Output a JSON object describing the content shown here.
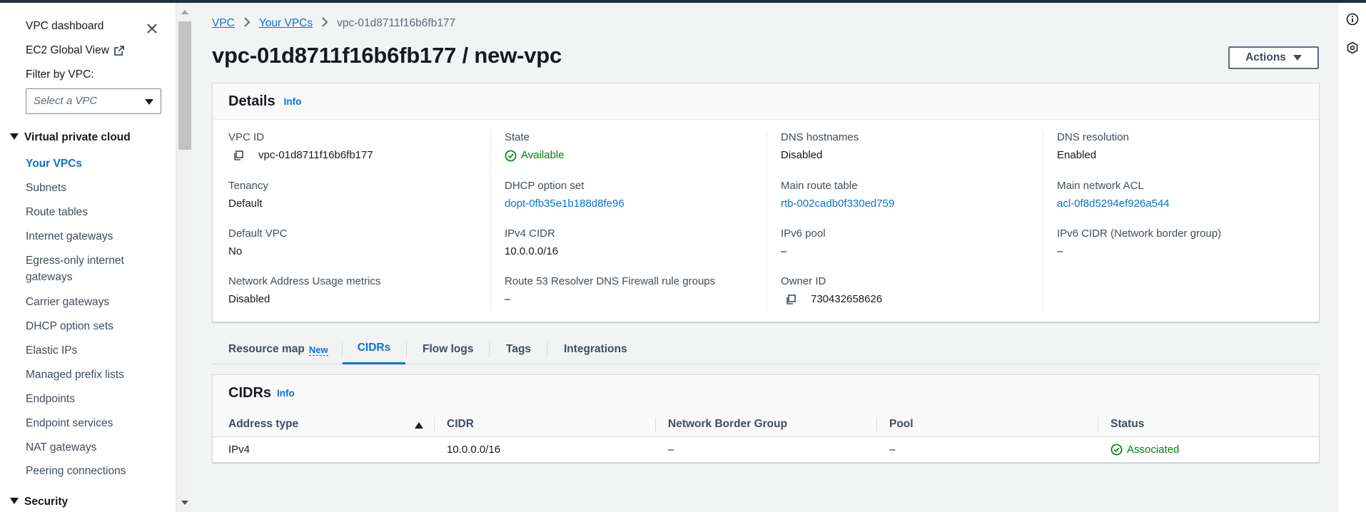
{
  "sidebar": {
    "dashboard_label": "VPC dashboard",
    "global_view_label": "EC2 Global View",
    "filter_label": "Filter by VPC:",
    "filter_placeholder": "Select a VPC",
    "section_vpc": "Virtual private cloud",
    "items": [
      "Your VPCs",
      "Subnets",
      "Route tables",
      "Internet gateways",
      "Egress-only internet gateways",
      "Carrier gateways",
      "DHCP option sets",
      "Elastic IPs",
      "Managed prefix lists",
      "Endpoints",
      "Endpoint services",
      "NAT gateways",
      "Peering connections"
    ],
    "active_item": "Your VPCs",
    "section_security": "Security"
  },
  "breadcrumb": {
    "root": "VPC",
    "parent": "Your VPCs",
    "current": "vpc-01d8711f16b6fb177"
  },
  "header": {
    "title": "vpc-01d8711f16b6fb177 / new-vpc",
    "actions_label": "Actions"
  },
  "details": {
    "title": "Details",
    "info_label": "Info",
    "vpc_id_label": "VPC ID",
    "vpc_id_value": "vpc-01d8711f16b6fb177",
    "state_label": "State",
    "state_value": "Available",
    "dns_hostnames_label": "DNS hostnames",
    "dns_hostnames_value": "Disabled",
    "dns_resolution_label": "DNS resolution",
    "dns_resolution_value": "Enabled",
    "tenancy_label": "Tenancy",
    "tenancy_value": "Default",
    "dhcp_label": "DHCP option set",
    "dhcp_value": "dopt-0fb35e1b188d8fe96",
    "main_route_label": "Main route table",
    "main_route_value": "rtb-002cadb0f330ed759",
    "main_acl_label": "Main network ACL",
    "main_acl_value": "acl-0f8d5294ef926a544",
    "default_vpc_label": "Default VPC",
    "default_vpc_value": "No",
    "ipv4_cidr_label": "IPv4 CIDR",
    "ipv4_cidr_value": "10.0.0.0/16",
    "ipv6_pool_label": "IPv6 pool",
    "ipv6_pool_value": "–",
    "ipv6_cidr_label": "IPv6 CIDR (Network border group)",
    "ipv6_cidr_value": "–",
    "nau_label": "Network Address Usage metrics",
    "nau_value": "Disabled",
    "r53_label": "Route 53 Resolver DNS Firewall rule groups",
    "r53_value": "–",
    "owner_label": "Owner ID",
    "owner_value": "730432658626"
  },
  "tabs": {
    "resource_map": "Resource map",
    "resource_map_badge": "New",
    "cidrs": "CIDRs",
    "flow_logs": "Flow logs",
    "tags": "Tags",
    "integrations": "Integrations"
  },
  "cidrs": {
    "title": "CIDRs",
    "info_label": "Info",
    "columns": [
      "Address type",
      "CIDR",
      "Network Border Group",
      "Pool",
      "Status"
    ],
    "rows": [
      {
        "address_type": "IPv4",
        "cidr": "10.0.0.0/16",
        "nbg": "–",
        "pool": "–",
        "status": "Associated"
      }
    ]
  },
  "colors": {
    "link": "#0972d3",
    "success": "#037f0c",
    "header_bar": "#232f3e"
  }
}
